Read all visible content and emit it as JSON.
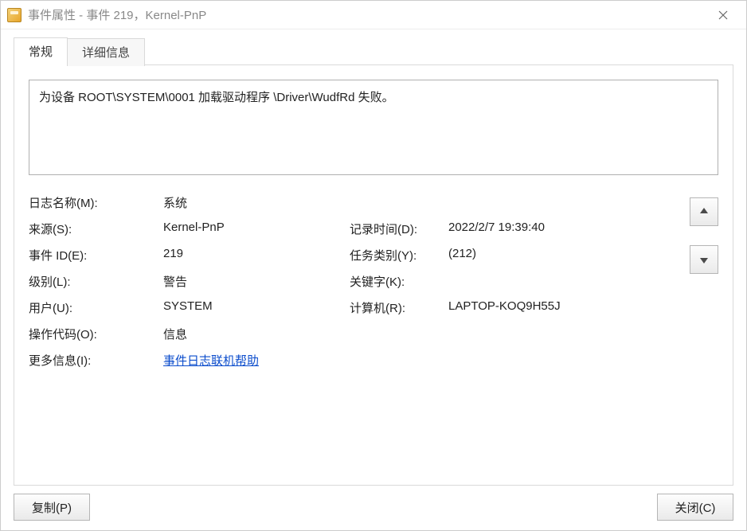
{
  "window": {
    "title": "事件属性 - 事件 219，Kernel-PnP"
  },
  "tabs": {
    "general": "常规",
    "details": "详细信息"
  },
  "message": "为设备 ROOT\\SYSTEM\\0001 加载驱动程序 \\Driver\\WudfRd 失败。",
  "labels": {
    "logName": "日志名称(M):",
    "source": "来源(S):",
    "eventId": "事件 ID(E):",
    "level": "级别(L):",
    "user": "用户(U):",
    "opcode": "操作代码(O):",
    "moreInfo": "更多信息(I):",
    "logged": "记录时间(D):",
    "taskCategory": "任务类别(Y):",
    "keywords": "关键字(K):",
    "computer": "计算机(R):"
  },
  "values": {
    "logName": "系统",
    "source": "Kernel-PnP",
    "eventId": "219",
    "level": "警告",
    "user": "SYSTEM",
    "opcode": "信息",
    "moreInfoLink": "事件日志联机帮助",
    "logged": "2022/2/7 19:39:40",
    "taskCategory": "(212)",
    "keywords": "",
    "computer": "LAPTOP-KOQ9H55J"
  },
  "buttons": {
    "copy": "复制(P)",
    "close": "关闭(C)"
  }
}
